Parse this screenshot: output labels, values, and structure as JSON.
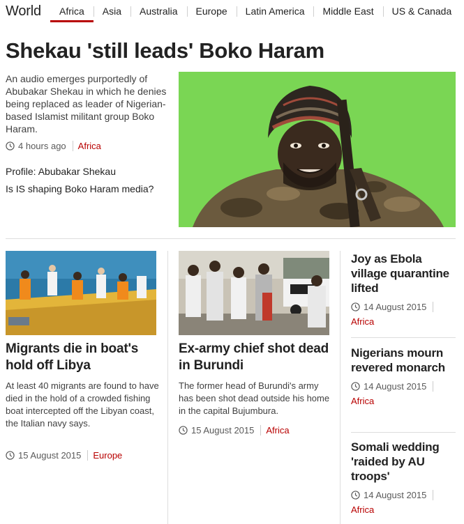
{
  "nav": {
    "title": "World",
    "items": [
      {
        "label": "Africa",
        "active": true
      },
      {
        "label": "Asia"
      },
      {
        "label": "Australia"
      },
      {
        "label": "Europe"
      },
      {
        "label": "Latin America"
      },
      {
        "label": "Middle East"
      },
      {
        "label": "US & Canada"
      }
    ]
  },
  "lead": {
    "headline": "Shekau 'still leads' Boko Haram",
    "summary": "An audio emerges purportedly of Abubakar Shekau in which he denies being replaced as leader of Nigerian-based Islamist militant group Boko Haram.",
    "time": "4 hours ago",
    "tag": "Africa",
    "related": [
      "Profile: Abubakar Shekau",
      "Is IS shaping Boko Haram media?"
    ]
  },
  "cards": [
    {
      "title": "Migrants die in boat's hold off Libya",
      "summary": "At least 40 migrants are found to have died in the hold of a crowded fishing boat intercepted off the Libyan coast, the Italian navy says.",
      "time": "15 August 2015",
      "tag": "Europe"
    },
    {
      "title": "Ex-army chief shot dead in Burundi",
      "summary": "The former head of Burundi's army has been shot dead outside his home in the capital Bujumbura.",
      "time": "15 August 2015",
      "tag": "Africa"
    }
  ],
  "side": [
    {
      "title": "Joy as Ebola village quarantine lifted",
      "time": "14 August 2015",
      "tag": "Africa"
    },
    {
      "title": "Nigerians mourn revered monarch",
      "time": "14 August 2015",
      "tag": "Africa"
    },
    {
      "title": "Somali wedding 'raided by AU troops'",
      "time": "14 August 2015",
      "tag": "Africa"
    }
  ],
  "colors": {
    "accent": "#b80000",
    "text": "#222222",
    "rule": "#dddddd"
  }
}
